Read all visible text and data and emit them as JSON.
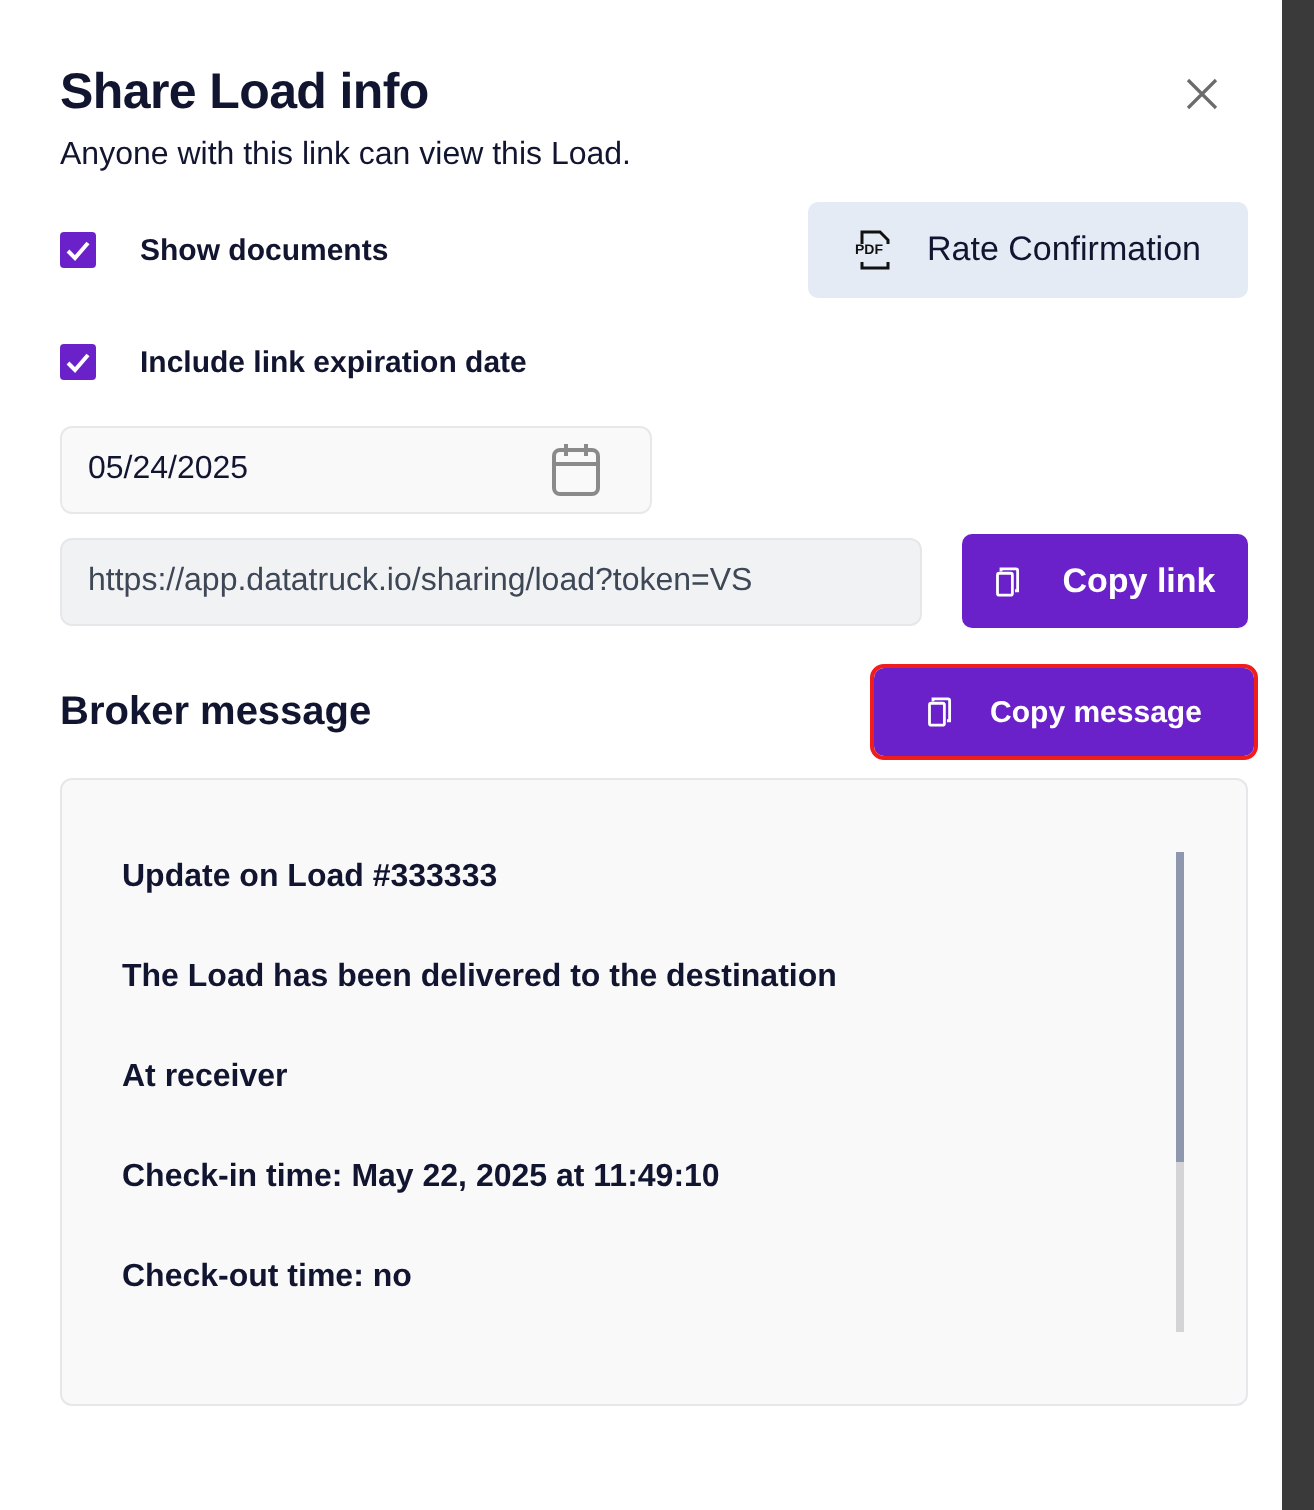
{
  "dialog": {
    "title": "Share Load info",
    "subtitle": "Anyone with this link can view this Load."
  },
  "options": [
    {
      "label": "Show documents",
      "checked": true
    },
    {
      "label": "Include link expiration date",
      "checked": true
    }
  ],
  "document_button": {
    "icon_text": "PDF",
    "label": "Rate Confirmation"
  },
  "expiration_date": {
    "value": "05/24/2025"
  },
  "link_field": {
    "value": "https://app.datatruck.io/sharing/load?token=VS"
  },
  "copy_link_button": {
    "label": "Copy link"
  },
  "broker_message": {
    "heading": "Broker message",
    "copy_button": {
      "label": "Copy message",
      "highlighted": true
    },
    "lines": [
      "Update on Load  #333333",
      "The Load has been delivered to the destination",
      "At receiver",
      "Check-in time: May 22, 2025 at 11:49:10",
      "Check-out time: no"
    ]
  }
}
